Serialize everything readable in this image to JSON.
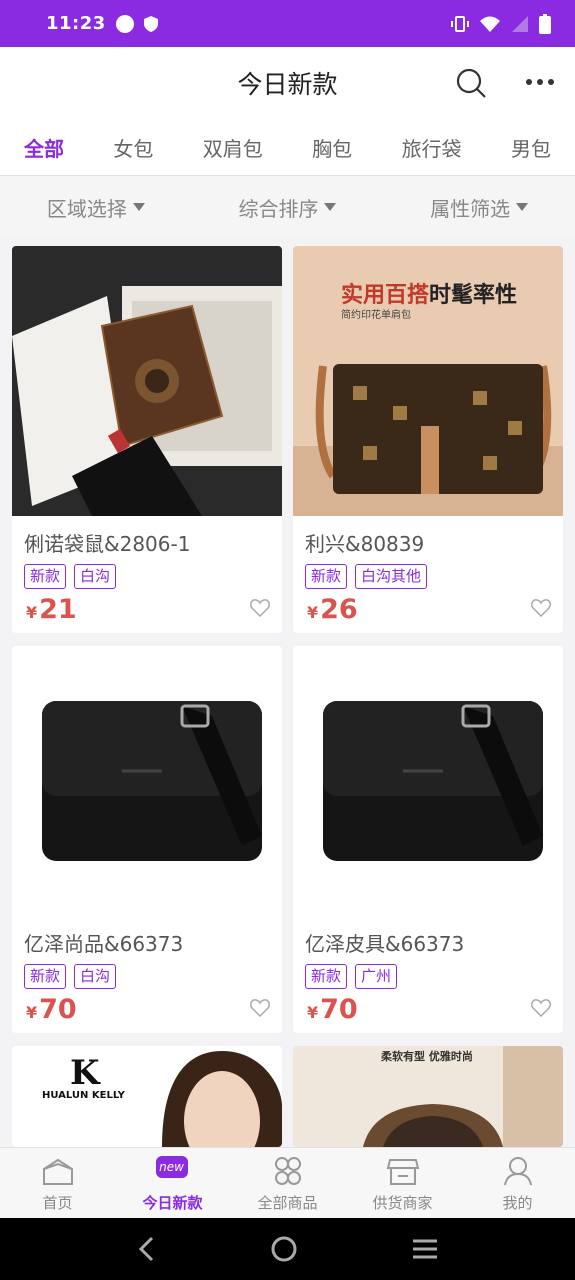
{
  "status": {
    "time": "11:23"
  },
  "header": {
    "title": "今日新款"
  },
  "categories": [
    "全部",
    "女包",
    "双肩包",
    "胸包",
    "旅行袋",
    "男包"
  ],
  "filters": [
    "区域选择",
    "综合排序",
    "属性筛选"
  ],
  "products": [
    {
      "name": "俐诺袋鼠&2806-1",
      "tags": [
        "新款",
        "白沟"
      ],
      "currency": "¥",
      "price": "21"
    },
    {
      "name": "利兴&80839",
      "tags": [
        "新款",
        "白沟其他"
      ],
      "currency": "¥",
      "price": "26",
      "image_text": {
        "headline_a": "实用百搭",
        "headline_b": "时髦率性",
        "sub": "简约印花单肩包"
      }
    },
    {
      "name": "亿泽尚品&66373",
      "tags": [
        "新款",
        "白沟"
      ],
      "currency": "¥",
      "price": "70"
    },
    {
      "name": "亿泽皮具&66373",
      "tags": [
        "新款",
        "广州"
      ],
      "currency": "¥",
      "price": "70"
    }
  ],
  "partial_cards": [
    {
      "brand": "HUALUN KELLY"
    },
    {
      "headline": "柔软有型 优雅时尚"
    }
  ],
  "bottom_nav": [
    {
      "label": "首页",
      "icon": "home-icon"
    },
    {
      "label": "今日新款",
      "icon": "new-icon",
      "badge": "new",
      "active": true
    },
    {
      "label": "全部商品",
      "icon": "grid-icon"
    },
    {
      "label": "供货商家",
      "icon": "store-icon"
    },
    {
      "label": "我的",
      "icon": "user-icon"
    }
  ],
  "colors": {
    "accent": "#8a2be2",
    "price": "#d9534f"
  }
}
